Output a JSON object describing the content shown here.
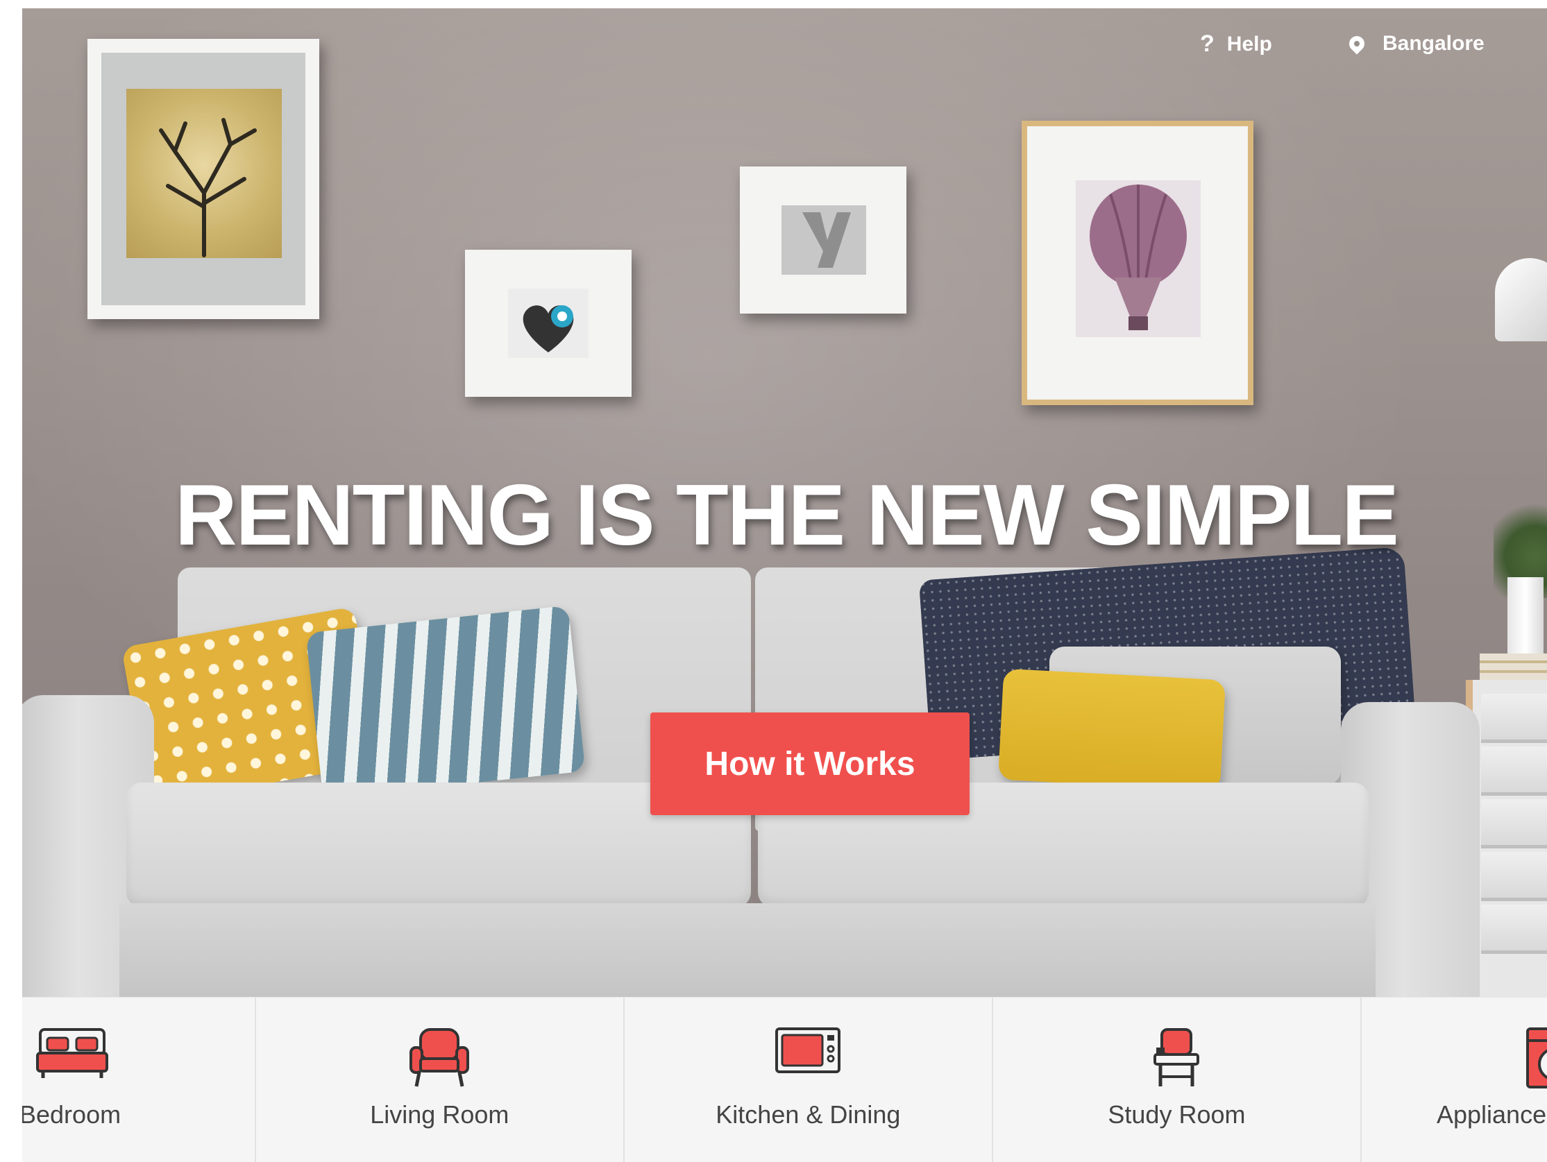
{
  "nav": {
    "help_icon": "?",
    "help_label": "Help",
    "location_icon": "map-pin-icon",
    "location_label": "Bangalore"
  },
  "hero": {
    "headline": "RENTING IS THE NEW SIMPLE",
    "cta_label": "How it Works"
  },
  "colors": {
    "accent": "#f0504d",
    "category_text": "#444444",
    "category_bar_bg": "#f5f5f5"
  },
  "categories": [
    {
      "label": "Bedroom",
      "icon": "bed-icon"
    },
    {
      "label": "Living Room",
      "icon": "armchair-icon"
    },
    {
      "label": "Kitchen & Dining",
      "icon": "microwave-icon"
    },
    {
      "label": "Study Room",
      "icon": "study-chair-icon"
    },
    {
      "label": "Appliance",
      "icon": "washing-machine-icon"
    }
  ]
}
